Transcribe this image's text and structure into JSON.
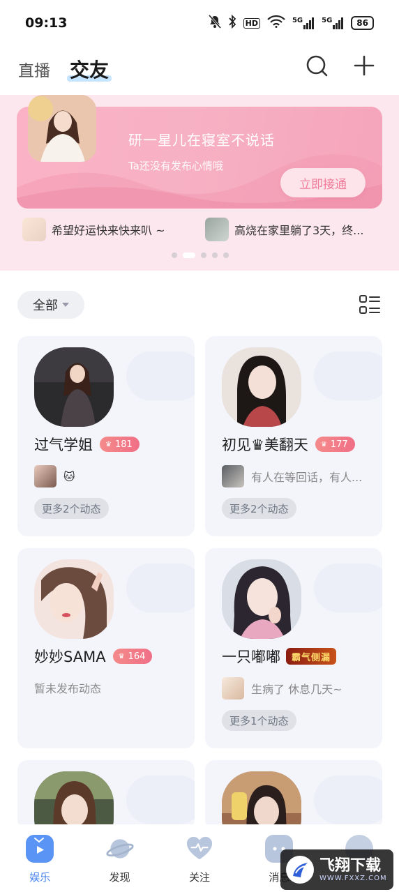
{
  "status_bar": {
    "time": "09:13",
    "signal_1": "5G",
    "signal_2": "5G",
    "hd_label": "HD",
    "battery": "86"
  },
  "header": {
    "tabs": [
      {
        "label": "直播",
        "active": false
      },
      {
        "label": "交友",
        "active": true
      }
    ],
    "icons": [
      "search-icon",
      "plus-icon"
    ]
  },
  "banner": {
    "title": "研一星儿在寝室不说话",
    "subtitle": "Ta还没有发布心情哦",
    "button_label": "立即接通",
    "ticker": [
      {
        "text": "希望好运快来快来叭 ~"
      },
      {
        "text": "高烧在家里躺了3天，终..."
      }
    ],
    "page_count": 5,
    "active_page": 1
  },
  "filter": {
    "selected": "全部",
    "view_toggle_icon": "list-view-icon"
  },
  "cards": [
    {
      "name": "过气学姐",
      "level": "181",
      "moment_text": "🐱",
      "more_label": "更多2个动态"
    },
    {
      "name": "初见♛美翻天",
      "level": "177",
      "moment_text": "有人在等回话，有人...",
      "more_label": "更多2个动态"
    },
    {
      "name": "妙妙SAMA",
      "level": "164",
      "no_moment": "暂未发布动态"
    },
    {
      "name": "一只嘟嘟",
      "honor_badge": "霸气侧漏",
      "moment_text": "生病了 休息几天~",
      "more_label": "更多1个动态"
    }
  ],
  "bottom_nav": [
    {
      "label": "娱乐",
      "icon": "tv-play-icon",
      "active": true
    },
    {
      "label": "发现",
      "icon": "planet-icon",
      "active": false
    },
    {
      "label": "关注",
      "icon": "heart-pulse-icon",
      "active": false
    },
    {
      "label": "消息",
      "icon": "chat-icon",
      "active": false
    },
    {
      "label": "",
      "icon": "profile-icon",
      "active": false
    }
  ],
  "watermark": {
    "title": "飞翔下载",
    "url": "WWW.FXXZ.COM"
  },
  "colors": {
    "accent_blue": "#4a84f0",
    "banner_pink": "#f7b1c4",
    "level_badge": "#f06f86",
    "card_bg": "#f4f5fb"
  }
}
